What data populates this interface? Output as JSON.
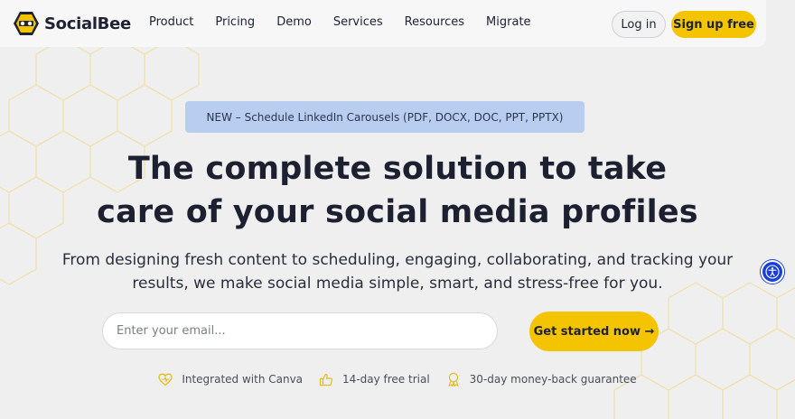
{
  "brand": {
    "name": "SocialBee",
    "accent": "#f5c400",
    "text": "#1e2233"
  },
  "nav": {
    "links": [
      "Product",
      "Pricing",
      "Demo",
      "Services",
      "Resources",
      "Migrate"
    ],
    "login_label": "Log in",
    "signup_label": "Sign up free"
  },
  "hero": {
    "badge": "NEW – Schedule LinkedIn Carousels (PDF, DOCX, DOC, PPT, PPTX)",
    "headline_line1": "The complete solution to take",
    "headline_line2": "care of your social media profiles",
    "subtext_line1": "From designing fresh content to scheduling, engaging, collaborating, and tracking your",
    "subtext_line2": "results, we make social media simple, smart, and stress-free for you.",
    "email_placeholder": "Enter your email...",
    "email_value": "",
    "cta_label": "Get started now →"
  },
  "perks": [
    {
      "icon": "canva-heart-icon",
      "label": "Integrated with Canva"
    },
    {
      "icon": "thumbs-up-icon",
      "label": "14-day free trial"
    },
    {
      "icon": "award-ribbon-icon",
      "label": "30-day money-back guarantee"
    }
  ],
  "accessibility": {
    "icon": "accessibility-icon",
    "color": "#1a3fd9"
  }
}
